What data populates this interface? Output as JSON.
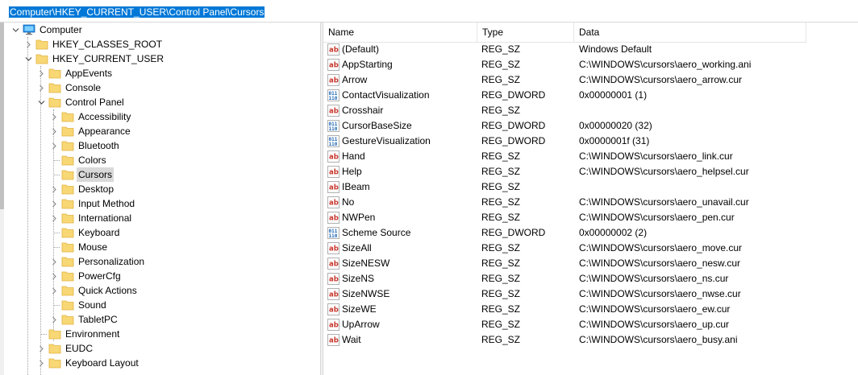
{
  "address": "Computer\\HKEY_CURRENT_USER\\Control Panel\\Cursors",
  "colors": {
    "selection": "#0078d7",
    "folder": "#f8d775",
    "folder_dark": "#e2b33c",
    "string_icon": "#c8372d",
    "dword_icon": "#1a64b4"
  },
  "tree": [
    {
      "label": "Computer",
      "level": 0,
      "state": "expanded",
      "icon": "computer-icon"
    },
    {
      "label": "HKEY_CLASSES_ROOT",
      "level": 1,
      "state": "collapsed",
      "icon": "folder-icon"
    },
    {
      "label": "HKEY_CURRENT_USER",
      "level": 1,
      "state": "expanded",
      "icon": "folder-icon"
    },
    {
      "label": "AppEvents",
      "level": 2,
      "state": "collapsed",
      "icon": "folder-icon"
    },
    {
      "label": "Console",
      "level": 2,
      "state": "collapsed",
      "icon": "folder-icon"
    },
    {
      "label": "Control Panel",
      "level": 2,
      "state": "expanded",
      "icon": "folder-icon"
    },
    {
      "label": "Accessibility",
      "level": 3,
      "state": "collapsed",
      "icon": "folder-icon"
    },
    {
      "label": "Appearance",
      "level": 3,
      "state": "collapsed",
      "icon": "folder-icon"
    },
    {
      "label": "Bluetooth",
      "level": 3,
      "state": "collapsed",
      "icon": "folder-icon"
    },
    {
      "label": "Colors",
      "level": 3,
      "state": "leaf",
      "icon": "folder-icon"
    },
    {
      "label": "Cursors",
      "level": 3,
      "state": "leaf",
      "icon": "folder-icon",
      "selected": true
    },
    {
      "label": "Desktop",
      "level": 3,
      "state": "collapsed",
      "icon": "folder-icon"
    },
    {
      "label": "Input Method",
      "level": 3,
      "state": "collapsed",
      "icon": "folder-icon"
    },
    {
      "label": "International",
      "level": 3,
      "state": "collapsed",
      "icon": "folder-icon"
    },
    {
      "label": "Keyboard",
      "level": 3,
      "state": "leaf",
      "icon": "folder-icon"
    },
    {
      "label": "Mouse",
      "level": 3,
      "state": "leaf",
      "icon": "folder-icon"
    },
    {
      "label": "Personalization",
      "level": 3,
      "state": "collapsed",
      "icon": "folder-icon"
    },
    {
      "label": "PowerCfg",
      "level": 3,
      "state": "collapsed",
      "icon": "folder-icon"
    },
    {
      "label": "Quick Actions",
      "level": 3,
      "state": "collapsed",
      "icon": "folder-icon"
    },
    {
      "label": "Sound",
      "level": 3,
      "state": "leaf",
      "icon": "folder-icon"
    },
    {
      "label": "TabletPC",
      "level": 3,
      "state": "collapsed",
      "icon": "folder-icon"
    },
    {
      "label": "Environment",
      "level": 2,
      "state": "leaf",
      "icon": "folder-icon"
    },
    {
      "label": "EUDC",
      "level": 2,
      "state": "collapsed",
      "icon": "folder-icon"
    },
    {
      "label": "Keyboard Layout",
      "level": 2,
      "state": "collapsed",
      "icon": "folder-icon"
    }
  ],
  "list": {
    "columns": [
      "Name",
      "Type",
      "Data"
    ],
    "rows": [
      {
        "name": "(Default)",
        "type": "REG_SZ",
        "data": "Windows Default",
        "icon": "string-value-icon"
      },
      {
        "name": "AppStarting",
        "type": "REG_SZ",
        "data": "C:\\WINDOWS\\cursors\\aero_working.ani",
        "icon": "string-value-icon"
      },
      {
        "name": "Arrow",
        "type": "REG_SZ",
        "data": "C:\\WINDOWS\\cursors\\aero_arrow.cur",
        "icon": "string-value-icon"
      },
      {
        "name": "ContactVisualization",
        "type": "REG_DWORD",
        "data": "0x00000001 (1)",
        "icon": "dword-value-icon"
      },
      {
        "name": "Crosshair",
        "type": "REG_SZ",
        "data": "",
        "icon": "string-value-icon"
      },
      {
        "name": "CursorBaseSize",
        "type": "REG_DWORD",
        "data": "0x00000020 (32)",
        "icon": "dword-value-icon"
      },
      {
        "name": "GestureVisualization",
        "type": "REG_DWORD",
        "data": "0x0000001f (31)",
        "icon": "dword-value-icon"
      },
      {
        "name": "Hand",
        "type": "REG_SZ",
        "data": "C:\\WINDOWS\\cursors\\aero_link.cur",
        "icon": "string-value-icon"
      },
      {
        "name": "Help",
        "type": "REG_SZ",
        "data": "C:\\WINDOWS\\cursors\\aero_helpsel.cur",
        "icon": "string-value-icon"
      },
      {
        "name": "IBeam",
        "type": "REG_SZ",
        "data": "",
        "icon": "string-value-icon"
      },
      {
        "name": "No",
        "type": "REG_SZ",
        "data": "C:\\WINDOWS\\cursors\\aero_unavail.cur",
        "icon": "string-value-icon"
      },
      {
        "name": "NWPen",
        "type": "REG_SZ",
        "data": "C:\\WINDOWS\\cursors\\aero_pen.cur",
        "icon": "string-value-icon"
      },
      {
        "name": "Scheme Source",
        "type": "REG_DWORD",
        "data": "0x00000002 (2)",
        "icon": "dword-value-icon"
      },
      {
        "name": "SizeAll",
        "type": "REG_SZ",
        "data": "C:\\WINDOWS\\cursors\\aero_move.cur",
        "icon": "string-value-icon"
      },
      {
        "name": "SizeNESW",
        "type": "REG_SZ",
        "data": "C:\\WINDOWS\\cursors\\aero_nesw.cur",
        "icon": "string-value-icon"
      },
      {
        "name": "SizeNS",
        "type": "REG_SZ",
        "data": "C:\\WINDOWS\\cursors\\aero_ns.cur",
        "icon": "string-value-icon"
      },
      {
        "name": "SizeNWSE",
        "type": "REG_SZ",
        "data": "C:\\WINDOWS\\cursors\\aero_nwse.cur",
        "icon": "string-value-icon"
      },
      {
        "name": "SizeWE",
        "type": "REG_SZ",
        "data": "C:\\WINDOWS\\cursors\\aero_ew.cur",
        "icon": "string-value-icon"
      },
      {
        "name": "UpArrow",
        "type": "REG_SZ",
        "data": "C:\\WINDOWS\\cursors\\aero_up.cur",
        "icon": "string-value-icon"
      },
      {
        "name": "Wait",
        "type": "REG_SZ",
        "data": "C:\\WINDOWS\\cursors\\aero_busy.ani",
        "icon": "string-value-icon"
      }
    ]
  }
}
